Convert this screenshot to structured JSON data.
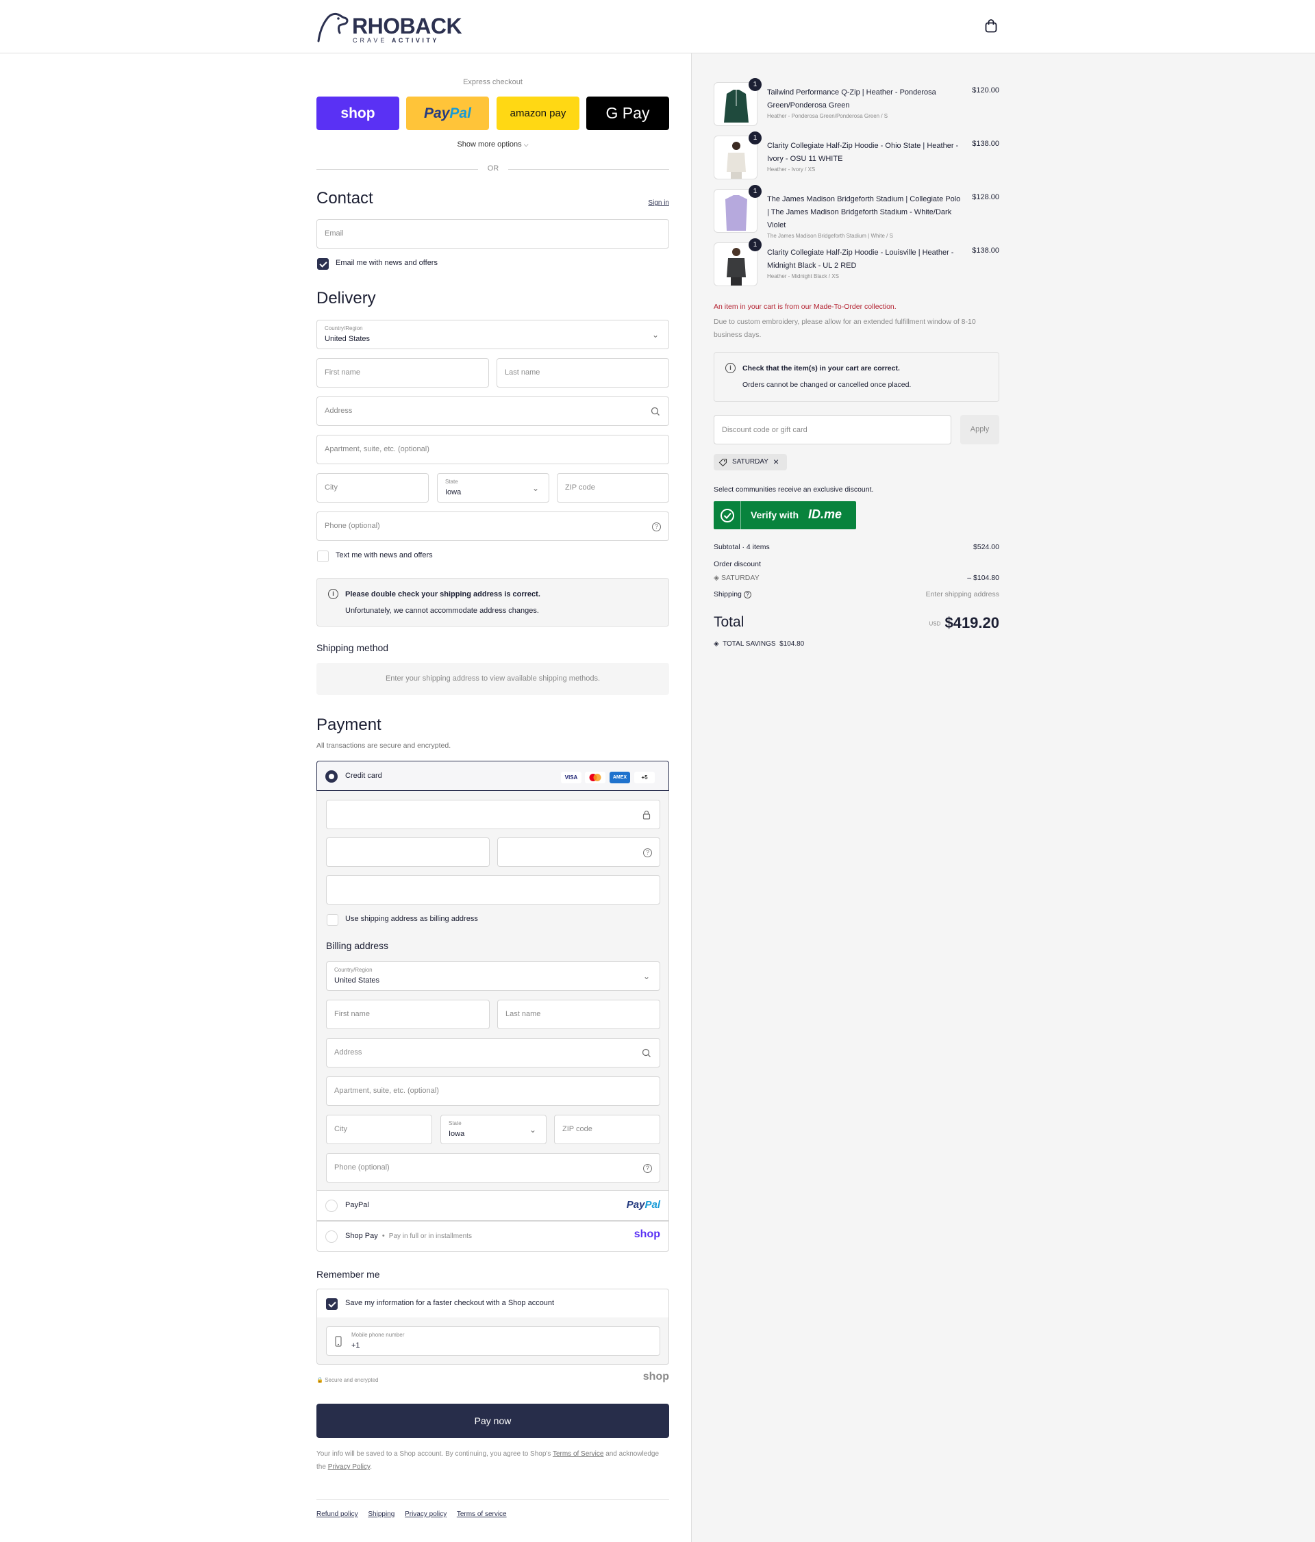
{
  "header": {
    "brand": "RHOBACK",
    "brand_sub_left": "CRAVE",
    "brand_sub_right": "ACTIVITY"
  },
  "express": {
    "label": "Express checkout",
    "buttons": {
      "shop": "shop",
      "paypal_a": "Pay",
      "paypal_b": "Pal",
      "amazon": "amazon pay",
      "gpay": "G Pay"
    },
    "more": "Show more options",
    "or": "OR"
  },
  "contact": {
    "title": "Contact",
    "sign_in": "Sign in",
    "email_placeholder": "Email",
    "news_label": "Email me with news and offers"
  },
  "delivery": {
    "title": "Delivery",
    "country_label": "Country/Region",
    "country": "United States",
    "first_name": "First name",
    "last_name": "Last name",
    "address": "Address",
    "apartment": "Apartment, suite, etc. (optional)",
    "city": "City",
    "state_label": "State",
    "state": "Iowa",
    "zip": "ZIP code",
    "phone": "Phone (optional)",
    "text_label": "Text me with news and offers",
    "notice_title": "Please double check your shipping address is correct.",
    "notice_body": "Unfortunately, we cannot accommodate address changes."
  },
  "shipping": {
    "title": "Shipping method",
    "message": "Enter your shipping address to view available shipping methods."
  },
  "payment": {
    "title": "Payment",
    "subtitle": "All transactions are secure and encrypted.",
    "credit_card": "Credit card",
    "badges": {
      "visa": "VISA",
      "amex": "AMEX",
      "more": "+5"
    },
    "use_shipping": "Use shipping address as billing address",
    "billing_title": "Billing address",
    "paypal": "PayPal",
    "paypal_logo_a": "Pay",
    "paypal_logo_b": "Pal",
    "shop_pay": "Shop Pay",
    "shop_pay_sub": "Pay in full or in installments",
    "shop_logo": "shop"
  },
  "remember": {
    "title": "Remember me",
    "save_label": "Save my information for a faster checkout with a Shop account",
    "mobile_label": "Mobile phone number",
    "mobile_value": "+1",
    "secure": "Secure and encrypted",
    "shop_logo": "shop"
  },
  "pay_now": "Pay now",
  "legal": {
    "prefix": "Your info will be saved to a Shop account. By continuing, you agree to Shop's",
    "tos": "Terms of Service",
    "mid": "and acknowledge the",
    "privacy": "Privacy Policy",
    "end": "."
  },
  "footer_links": [
    "Refund policy",
    "Shipping",
    "Privacy policy",
    "Terms of service"
  ],
  "cart": {
    "items": [
      {
        "qty": "1",
        "name": "Tailwind Performance Q-Zip | Heather - Ponderosa Green/Ponderosa Green",
        "variant": "Heather - Ponderosa Green/Ponderosa Green / S",
        "price": "$120.00",
        "color": "#1f4a3d"
      },
      {
        "qty": "1",
        "name": "Clarity Collegiate Half-Zip Hoodie - Ohio State | Heather - Ivory - OSU 11 WHITE",
        "variant": "Heather - Ivory / XS",
        "price": "$138.00",
        "color": "#e8e4dc"
      },
      {
        "qty": "1",
        "name": "The James Madison Bridgeforth Stadium | Collegiate Polo | The James Madison Bridgeforth Stadium - White/Dark Violet",
        "variant": "The James Madison Bridgeforth Stadium | White / S",
        "price": "$128.00",
        "color": "#b6a9dd"
      },
      {
        "qty": "1",
        "name": "Clarity Collegiate Half-Zip Hoodie - Louisville | Heather - Midnight Black - UL 2 RED",
        "variant": "Heather - Midnight Black / XS",
        "price": "$138.00",
        "color": "#3a3b3d"
      }
    ],
    "mto_note": "An item in your cart is from our Made-To-Order collection.",
    "mto_detail": "Due to custom embroidery, please allow for an extended fulfillment window of 8-10 business days.",
    "check_title": "Check that the item(s) in your cart are correct.",
    "check_body": "Orders cannot be changed or cancelled once placed.",
    "discount_placeholder": "Discount code or gift card",
    "apply": "Apply",
    "code": "SATURDAY",
    "communities": "Select communities receive an exclusive discount.",
    "idme_a": "Verify with",
    "idme_b": "ID.me",
    "subtotal_label": "Subtotal · 4 items",
    "subtotal": "$524.00",
    "order_discount": "Order discount",
    "discount_code": "SATURDAY",
    "discount_amount": "– $104.80",
    "shipping_label": "Shipping",
    "shipping_value": "Enter shipping address",
    "total_label": "Total",
    "currency": "USD",
    "total": "$419.20",
    "savings_label": "TOTAL SAVINGS",
    "savings": "$104.80"
  }
}
